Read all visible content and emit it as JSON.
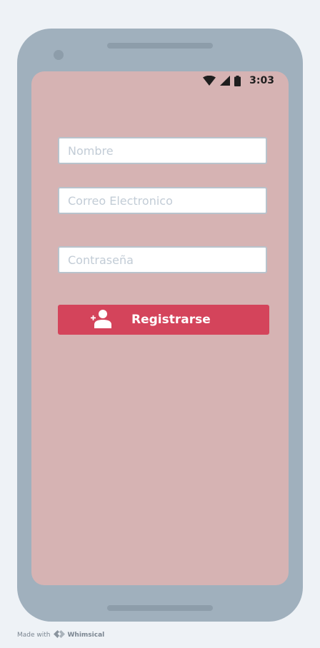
{
  "status_bar": {
    "time": "3:03",
    "icons": [
      "wifi-icon",
      "signal-icon",
      "battery-icon"
    ]
  },
  "form": {
    "name_placeholder": "Nombre",
    "email_placeholder": "Correo Electronico",
    "password_placeholder": "Contraseña",
    "register_label": "Registrarse",
    "register_icon": "add-user-icon"
  },
  "watermark": {
    "made_with": "Made with",
    "brand": "Whimsical"
  },
  "colors": {
    "page_background": "#eef2f6",
    "device_frame": "#a0b0bd",
    "screen_background": "#d6b3b3",
    "button_background": "#d4445b",
    "field_border": "#b9c3cc",
    "placeholder_text": "#c2ccd6"
  }
}
